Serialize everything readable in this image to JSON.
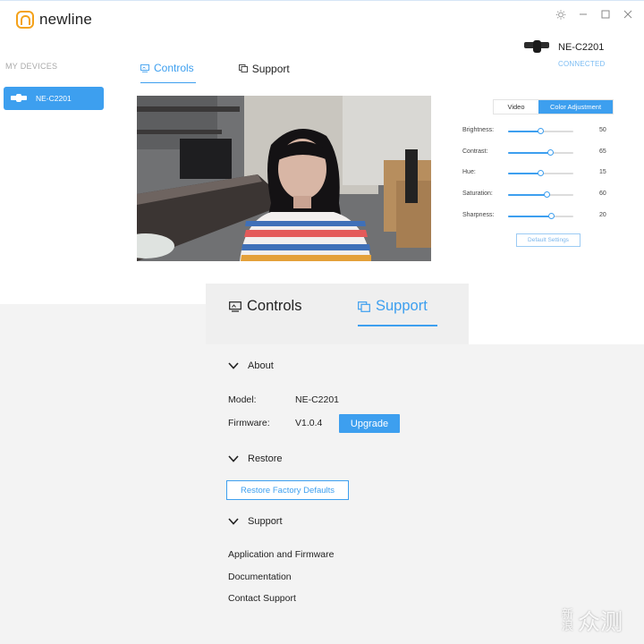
{
  "app": {
    "brand": "newline",
    "sidebar_heading": "MY DEVICES",
    "devices": [
      {
        "label": "NE-C2201"
      }
    ],
    "tabs": [
      {
        "label": "Controls",
        "active": true
      },
      {
        "label": "Support",
        "active": false
      }
    ],
    "device_name": "NE-C2201",
    "device_status": "CONNECTED",
    "icons": [
      "settings-icon",
      "minimize-icon",
      "maximize-icon",
      "close-icon",
      "camera-icon",
      "controls-icon",
      "support-icon",
      "chevron-down-icon"
    ],
    "colors": {
      "accent": "#3d9fef",
      "brand": "#f4a21b"
    }
  },
  "adjust": {
    "mode_tabs": [
      {
        "label": "Video",
        "active": false
      },
      {
        "label": "Color Adjustment",
        "active": true
      }
    ],
    "sliders": [
      {
        "label": "Brightness:",
        "value": 50,
        "max": 100
      },
      {
        "label": "Contrast:",
        "value": 65,
        "max": 100
      },
      {
        "label": "Hue:",
        "value": 15,
        "max": 30
      },
      {
        "label": "Saturation:",
        "value": 60,
        "max": 100
      },
      {
        "label": "Sharpness:",
        "value": 20,
        "max": 30
      }
    ],
    "default_button": "Default Settings"
  },
  "support": {
    "tabs": [
      {
        "label": "Controls",
        "active": false
      },
      {
        "label": "Support",
        "active": true
      }
    ],
    "about_heading": "About",
    "model_label": "Model:",
    "model_value": "NE-C2201",
    "firmware_label": "Firmware:",
    "firmware_value": "V1.0.4",
    "upgrade_button": "Upgrade",
    "restore_heading": "Restore",
    "restore_button": "Restore Factory Defaults",
    "support_heading": "Support",
    "links": [
      "Application and Firmware",
      "Documentation",
      "Contact Support"
    ]
  },
  "watermark": {
    "small_top": "新",
    "small_bottom": "浪",
    "large": "众测"
  }
}
